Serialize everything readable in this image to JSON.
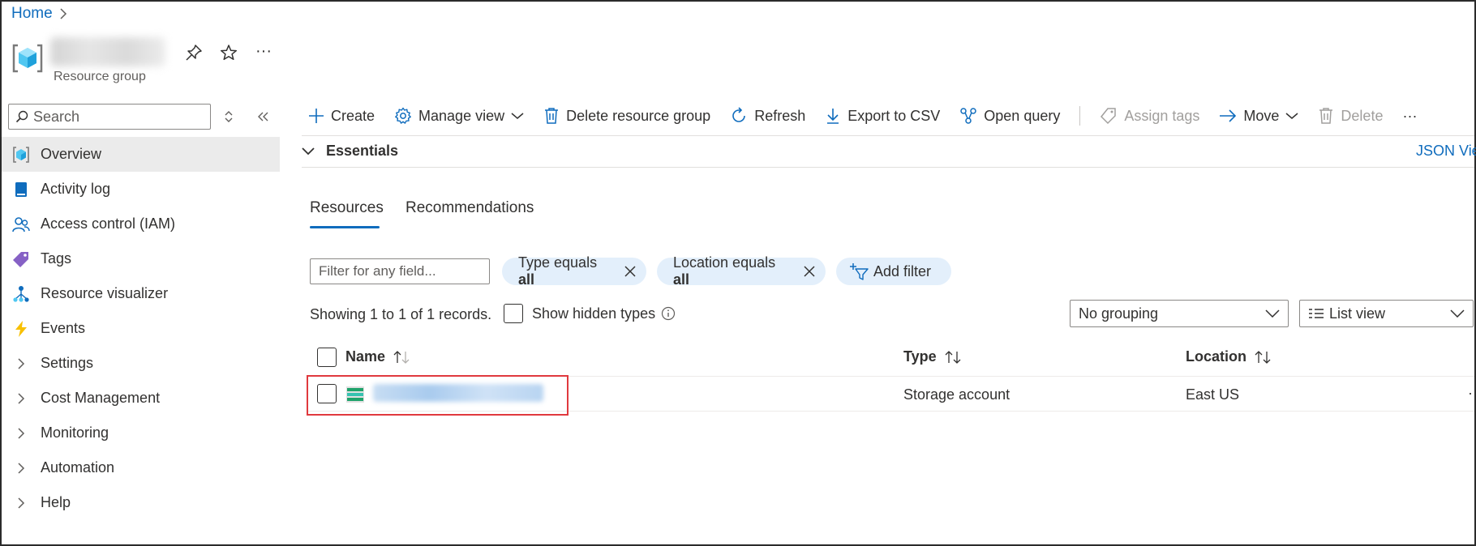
{
  "breadcrumb": {
    "home": "Home"
  },
  "header": {
    "resource_type": "Resource group"
  },
  "sidebar": {
    "search_placeholder": "Search",
    "items": [
      {
        "label": "Overview",
        "icon": "resource-group-icon",
        "active": true
      },
      {
        "label": "Activity log",
        "icon": "activity-log-icon"
      },
      {
        "label": "Access control (IAM)",
        "icon": "people-icon"
      },
      {
        "label": "Tags",
        "icon": "tag-icon"
      },
      {
        "label": "Resource visualizer",
        "icon": "visualizer-icon"
      },
      {
        "label": "Events",
        "icon": "lightning-icon"
      },
      {
        "label": "Settings",
        "icon": "chevron-right-icon"
      },
      {
        "label": "Cost Management",
        "icon": "chevron-right-icon"
      },
      {
        "label": "Monitoring",
        "icon": "chevron-right-icon"
      },
      {
        "label": "Automation",
        "icon": "chevron-right-icon"
      },
      {
        "label": "Help",
        "icon": "chevron-right-icon"
      }
    ]
  },
  "toolbar": {
    "create": "Create",
    "manage_view": "Manage view",
    "delete_rg": "Delete resource group",
    "refresh": "Refresh",
    "export_csv": "Export to CSV",
    "open_query": "Open query",
    "assign_tags": "Assign tags",
    "move": "Move",
    "delete": "Delete",
    "more": "···"
  },
  "essentials": {
    "label": "Essentials",
    "json_view": "JSON View"
  },
  "tabs": {
    "resources": "Resources",
    "recommendations": "Recommendations"
  },
  "filters": {
    "placeholder": "Filter for any field...",
    "type_prefix": "Type equals ",
    "type_value": "all",
    "location_prefix": "Location equals ",
    "location_value": "all",
    "add_filter": "Add filter"
  },
  "records": {
    "summary": "Showing 1 to 1 of 1 records.",
    "show_hidden": "Show hidden types",
    "grouping": "No grouping",
    "view": "List view"
  },
  "table": {
    "headers": {
      "name": "Name",
      "type": "Type",
      "location": "Location"
    },
    "rows": [
      {
        "type": "Storage account",
        "location": "East US"
      }
    ]
  },
  "colors": {
    "accent": "#0f6cbd",
    "highlight": "#e0393e",
    "pill": "#e3effb"
  }
}
